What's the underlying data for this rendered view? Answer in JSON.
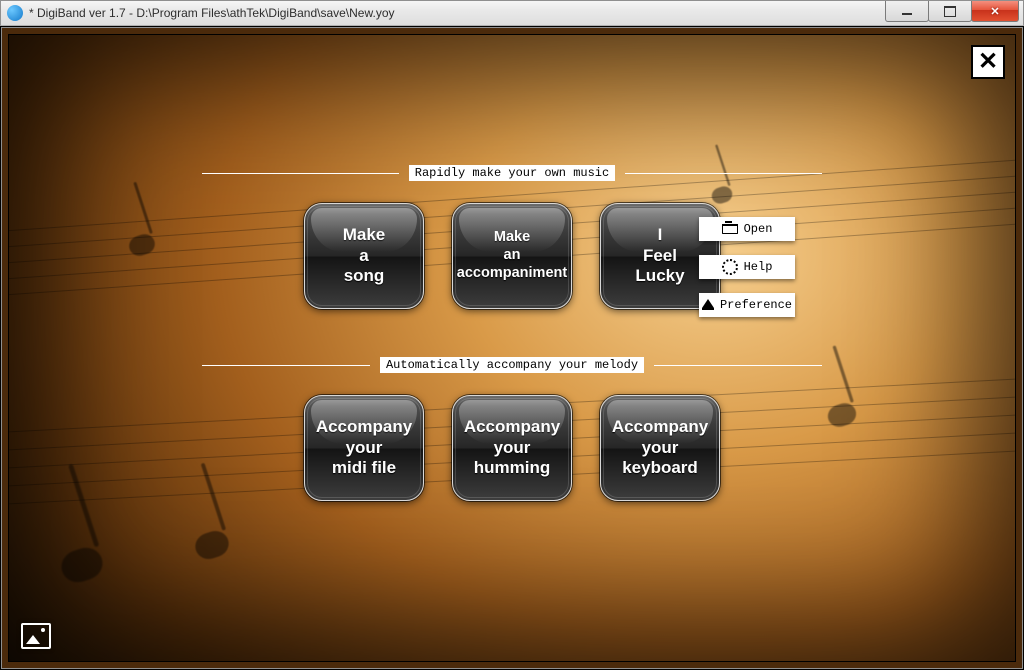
{
  "window": {
    "title": "* DigiBand ver 1.7    -   D:\\Program Files\\athTek\\DigiBand\\save\\New.yoy"
  },
  "sections": {
    "make": {
      "label": "Rapidly make your own music",
      "tiles": [
        {
          "label": "Make\na\nsong"
        },
        {
          "label": "Make\nan\naccompaniment"
        },
        {
          "label": "I\nFeel\nLucky"
        }
      ]
    },
    "accompany": {
      "label": "Automatically accompany your melody",
      "tiles": [
        {
          "label": "Accompany\nyour\nmidi file"
        },
        {
          "label": "Accompany\nyour\nhumming"
        },
        {
          "label": "Accompany\nyour\nkeyboard"
        }
      ]
    }
  },
  "side_buttons": {
    "open": "Open",
    "help": "Help",
    "preference": "Preference"
  }
}
